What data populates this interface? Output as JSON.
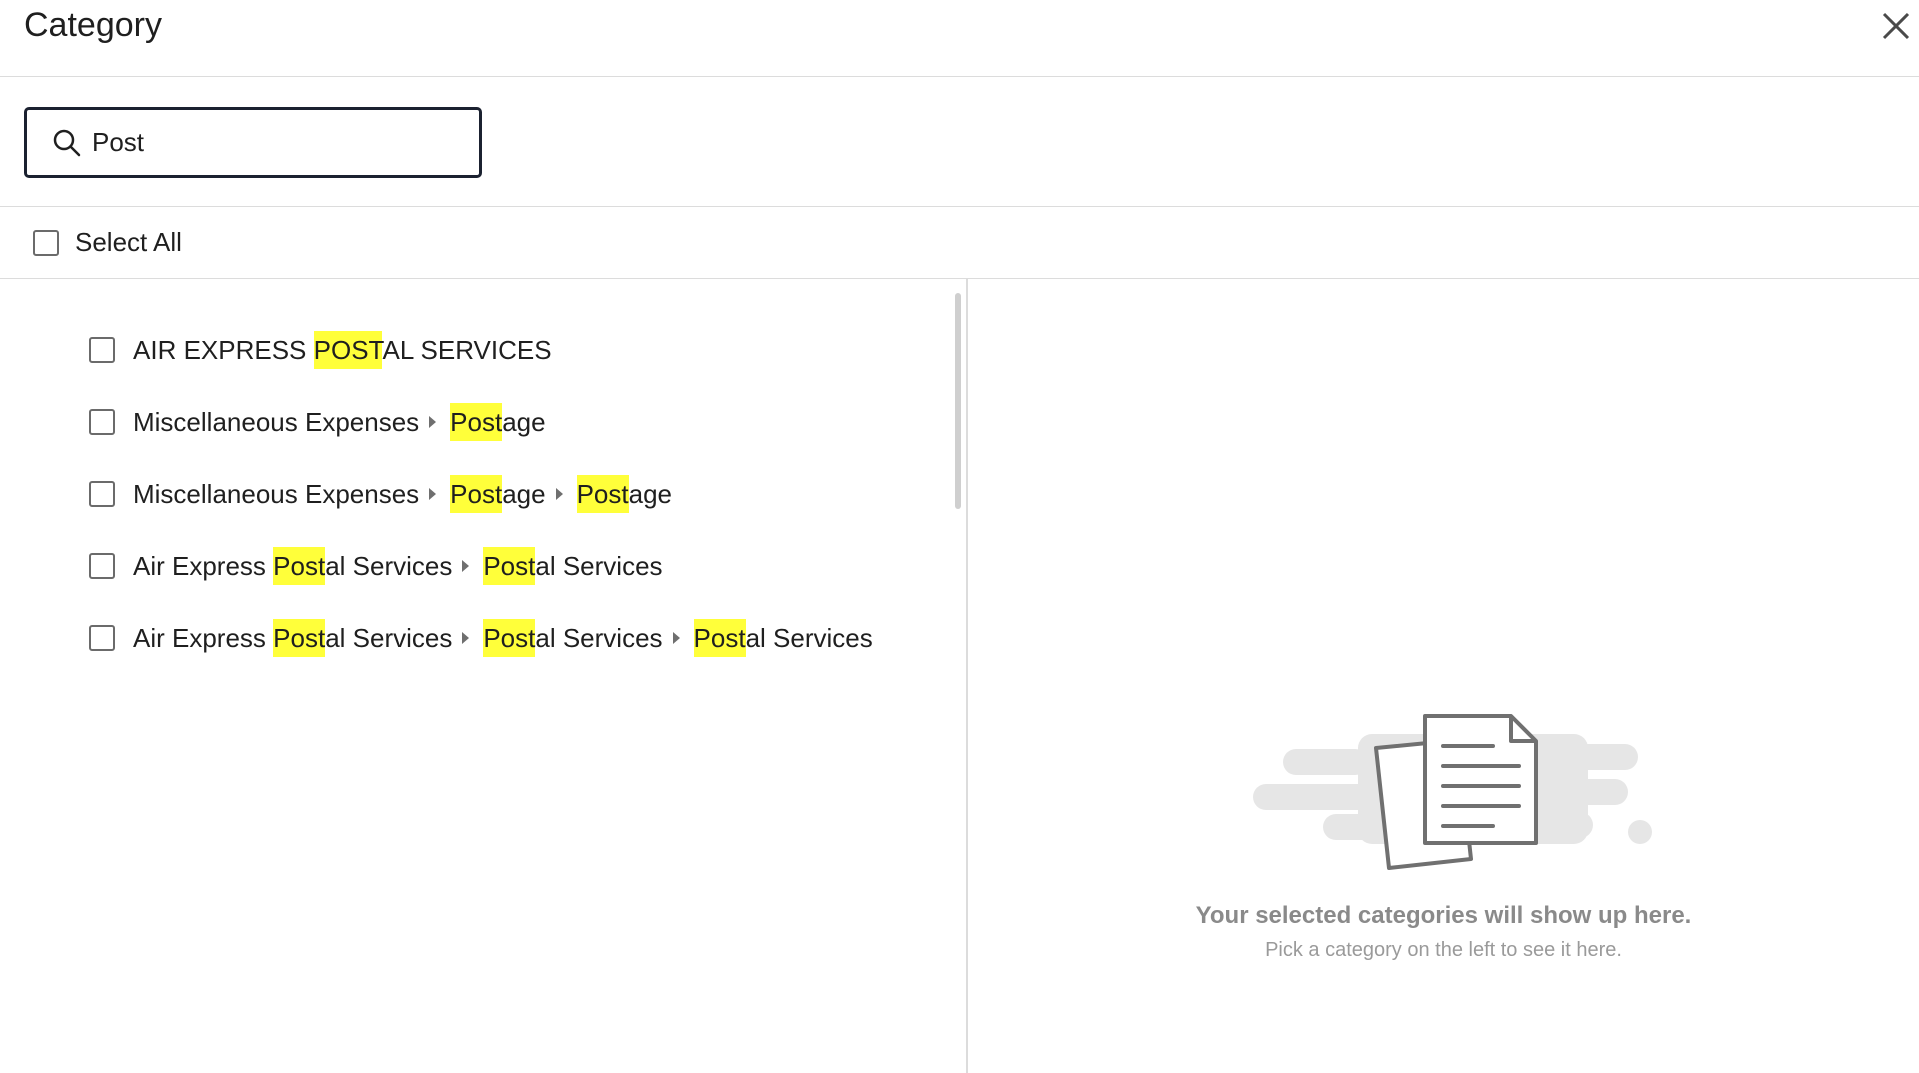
{
  "dialog": {
    "title": "Category"
  },
  "search": {
    "value": "Post",
    "icon": "search-icon"
  },
  "select_all": {
    "label": "Select All",
    "checked": false
  },
  "results": [
    {
      "checked": false,
      "path": [
        {
          "before": "AIR EXPRESS ",
          "match": "POST",
          "after": "AL SERVICES"
        }
      ]
    },
    {
      "checked": false,
      "path": [
        {
          "before": "Miscellaneous Expenses",
          "match": "",
          "after": ""
        },
        {
          "before": "",
          "match": "Post",
          "after": "age"
        }
      ]
    },
    {
      "checked": false,
      "path": [
        {
          "before": "Miscellaneous Expenses",
          "match": "",
          "after": ""
        },
        {
          "before": "",
          "match": "Post",
          "after": "age"
        },
        {
          "before": "",
          "match": "Post",
          "after": "age"
        }
      ]
    },
    {
      "checked": false,
      "path": [
        {
          "before": "Air Express ",
          "match": "Post",
          "after": "al Services"
        },
        {
          "before": "",
          "match": "Post",
          "after": "al Services"
        }
      ]
    },
    {
      "checked": false,
      "path": [
        {
          "before": "Air Express ",
          "match": "Post",
          "after": "al Services"
        },
        {
          "before": "",
          "match": "Post",
          "after": "al Services"
        },
        {
          "before": "",
          "match": "Post",
          "after": "al Services"
        }
      ]
    }
  ],
  "empty_state": {
    "title": "Your selected categories will show up here.",
    "subtitle": "Pick a category on the left to see it here.",
    "icon": "document-icon"
  },
  "colors": {
    "highlight": "#ffff3a",
    "border": "#1b2130",
    "muted": "#8a8a8a"
  }
}
